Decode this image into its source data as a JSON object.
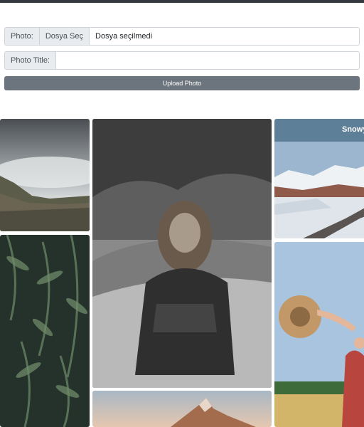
{
  "form": {
    "photo_label": "Photo:",
    "file_button": "Dosya Seç",
    "file_status": "Dosya seçilmedi",
    "title_label": "Photo Title:",
    "title_value": "",
    "upload_button": "Upload Photo"
  },
  "gallery": {
    "photos": [
      {
        "subject": "misty mountains"
      },
      {
        "subject": "fern leaves"
      },
      {
        "subject": "woman on car (black and white)"
      },
      {
        "subject": "mountain peak at sunset"
      },
      {
        "subject": "snowy mountains and road",
        "caption": "Snowy"
      },
      {
        "subject": "woman holding straw hat in field"
      }
    ]
  },
  "colors": {
    "topbar": "#343a40",
    "upload_button": "#6c757d",
    "caption_band": "#5e7f98"
  }
}
